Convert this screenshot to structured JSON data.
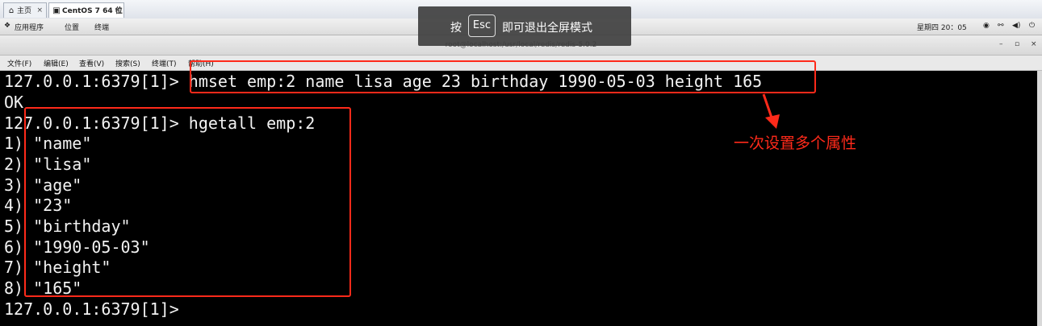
{
  "tabs": [
    {
      "label": "主页",
      "icon": "home-icon"
    },
    {
      "label": "CentOS 7 64 位",
      "icon": "vm-icon"
    }
  ],
  "tab_close_glyph": "×",
  "panel": {
    "apps": "应用程序",
    "places": "位置",
    "terminal": "终端",
    "clock": "星期四 20：05"
  },
  "window_title": "root@localhost:/usr/local/redis/redis-5.0.2",
  "window_controls": {
    "minimize": "–",
    "maximize": "▫",
    "close": "×"
  },
  "menu": [
    "文件(F)",
    "编辑(E)",
    "查看(V)",
    "搜索(S)",
    "终端(T)",
    "帮助(H)"
  ],
  "overlay": {
    "prefix": "按",
    "key": "Esc",
    "suffix": "即可退出全屏模式"
  },
  "terminal_lines": [
    "127.0.0.1:6379[1]> hmset emp:2 name lisa age 23 birthday 1990-05-03 height 165",
    "OK",
    "127.0.0.1:6379[1]> hgetall emp:2",
    "1) \"name\"",
    "2) \"lisa\"",
    "3) \"age\"",
    "4) \"23\"",
    "5) \"birthday\"",
    "6) \"1990-05-03\"",
    "7) \"height\"",
    "8) \"165\"",
    "127.0.0.1:6379[1]>"
  ],
  "annotation": "一次设置多个属性",
  "colors": {
    "annotation": "#ff2a1a",
    "terminal_bg": "#000000",
    "terminal_fg": "#f2f2f2"
  }
}
